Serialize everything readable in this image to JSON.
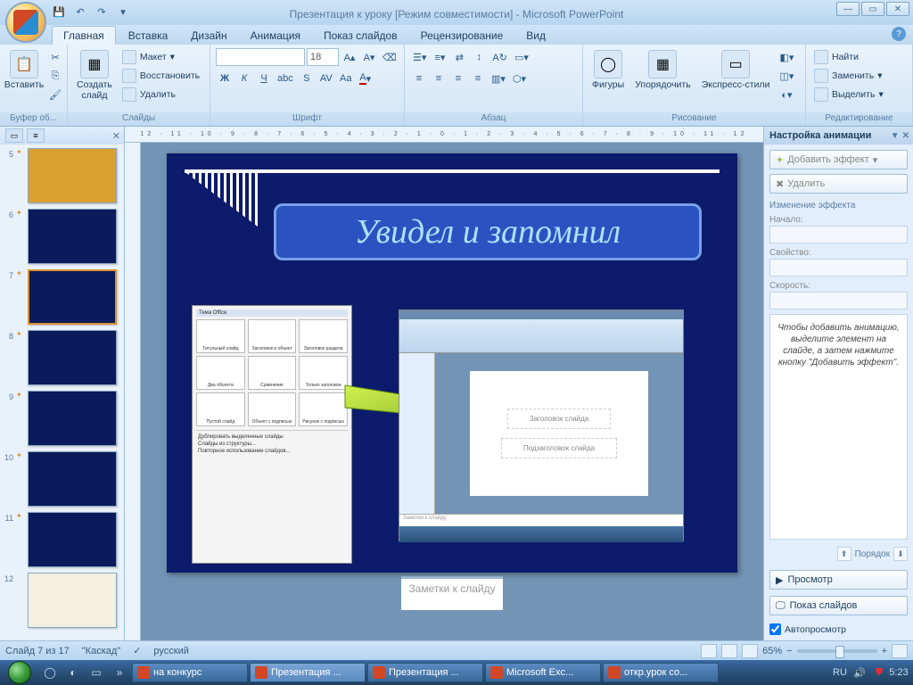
{
  "titlebar": {
    "title": "Презентация к уроку [Режим совместимости] - Microsoft PowerPoint"
  },
  "ribbonTabs": [
    "Главная",
    "Вставка",
    "Дизайн",
    "Анимация",
    "Показ слайдов",
    "Рецензирование",
    "Вид"
  ],
  "activeTab": 0,
  "ribbon": {
    "clipboard": {
      "label": "Буфер об...",
      "paste": "Вставить"
    },
    "slides": {
      "label": "Слайды",
      "new": "Создать\nслайд",
      "layout": "Макет",
      "reset": "Восстановить",
      "delete": "Удалить"
    },
    "font": {
      "label": "Шрифт",
      "family": "",
      "size": "18"
    },
    "paragraph": {
      "label": "Абзац"
    },
    "drawing": {
      "label": "Рисование",
      "shapes": "Фигуры",
      "arrange": "Упорядочить",
      "styles": "Экспресс-стили"
    },
    "editing": {
      "label": "Редактирование",
      "find": "Найти",
      "replace": "Заменить",
      "select": "Выделить"
    }
  },
  "thumbs": [
    {
      "n": "5",
      "anim": true,
      "bg": "#d8a030"
    },
    {
      "n": "6",
      "anim": true,
      "bg": "#0a1a5a"
    },
    {
      "n": "7",
      "anim": true,
      "bg": "#0a1a5a",
      "active": true
    },
    {
      "n": "8",
      "anim": true,
      "bg": "#0a1a5a"
    },
    {
      "n": "9",
      "anim": true,
      "bg": "#0a1a5a"
    },
    {
      "n": "10",
      "anim": true,
      "bg": "#0a1a5a"
    },
    {
      "n": "11",
      "anim": true,
      "bg": "#0a1a5a"
    },
    {
      "n": "12",
      "anim": false,
      "bg": "#f4f0e0"
    }
  ],
  "slide": {
    "title": "Увидел и запомнил",
    "layoutPanel": {
      "header": "Тема Office",
      "cells": [
        "Титульный слайд",
        "Заголовок и объект",
        "Заголовок раздела",
        "Два объекта",
        "Сравнение",
        "Только заголовок",
        "Пустой слайд",
        "Объект с подписью",
        "Рисунок с подписью"
      ],
      "opts": [
        "Дублировать выделенные слайды",
        "Слайды из структуры...",
        "Повторное использование слайдов..."
      ]
    },
    "mini": {
      "slideTitle": "Заголовок слайда",
      "slideSub": "Подзаголовок слайда",
      "notes": "Заметки к слайду"
    }
  },
  "notes": "Заметки к слайду",
  "anim": {
    "title": "Настройка анимации",
    "addEffect": "Добавить эффект",
    "remove": "Удалить",
    "section": "Изменение эффекта",
    "start": "Начало:",
    "property": "Свойство:",
    "speed": "Скорость:",
    "message": "Чтобы добавить анимацию, выделите элемент на слайде, а затем нажмите кнопку \"Добавить эффект\".",
    "order": "Порядок",
    "preview": "Просмотр",
    "slideshow": "Показ слайдов",
    "autopreview": "Автопросмотр"
  },
  "status": {
    "slide": "Слайд 7 из 17",
    "theme": "\"Каскад\"",
    "lang": "русский",
    "zoom": "65%"
  },
  "taskbar": {
    "items": [
      "на конкурс",
      "Презентация ...",
      "Презентация ...",
      "Microsoft Exc...",
      "откр.урок со..."
    ],
    "lang": "RU",
    "time": "5:23"
  }
}
